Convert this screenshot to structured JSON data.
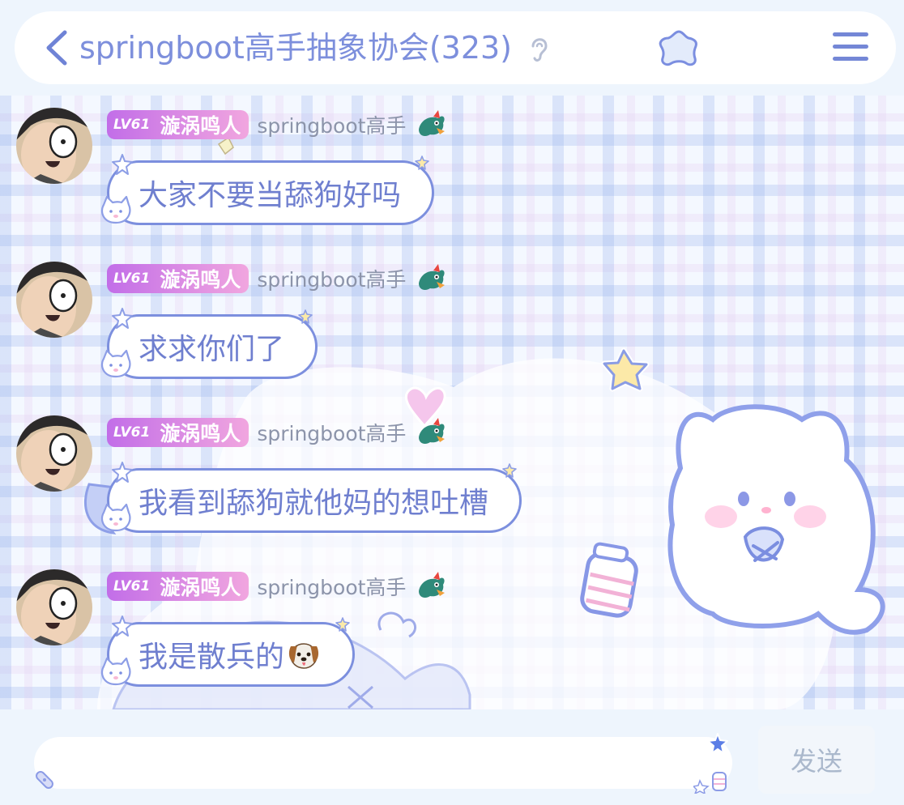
{
  "header": {
    "title": "springboot高手抽象协会(323)",
    "icons": {
      "back": "chevron-left-icon",
      "ear": "ear-icon",
      "star": "star-icon",
      "menu": "menu-icon"
    }
  },
  "messages": [
    {
      "level": "LV61",
      "nickname": "漩涡鸣人",
      "title_tag": "springboot高手",
      "text": "大家不要当舔狗好吗"
    },
    {
      "level": "LV61",
      "nickname": "漩涡鸣人",
      "title_tag": "springboot高手",
      "text": "求求你们了"
    },
    {
      "level": "LV61",
      "nickname": "漩涡鸣人",
      "title_tag": "springboot高手",
      "text": "我看到舔狗就他妈的想吐槽"
    },
    {
      "level": "LV61",
      "nickname": "漩涡鸣人",
      "title_tag": "springboot高手",
      "text": "我是散兵的",
      "emoji": "dog-face-icon"
    }
  ],
  "input": {
    "value": "",
    "placeholder": ""
  },
  "send": {
    "label": "发送"
  },
  "colors": {
    "accent": "#7d8fdc",
    "badge_start": "#c26ee8",
    "badge_end": "#f1a6df",
    "bubble_border": "#7c8fde"
  }
}
